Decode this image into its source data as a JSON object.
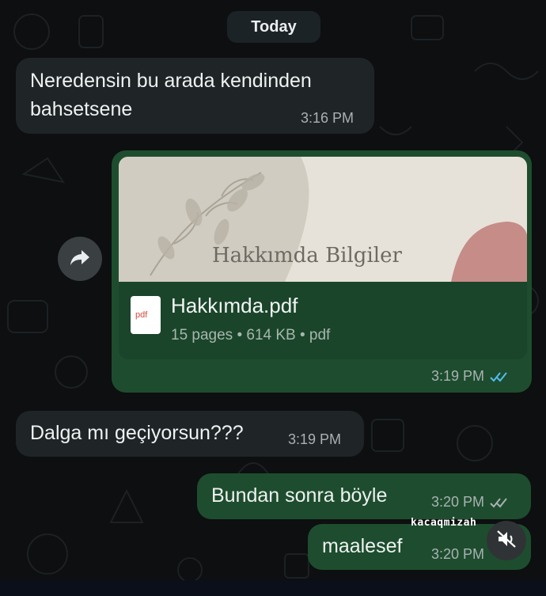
{
  "date_separator": "Today",
  "messages": [
    {
      "text_line1": "Neredensin bu arada kendinden",
      "text_line2": "bahsetsene",
      "time": "3:16 PM",
      "direction": "incoming"
    },
    {
      "direction": "outgoing",
      "document": {
        "preview_title": "Hakkımda Bilgiler",
        "file_name": "Hakkımda.pdf",
        "file_info": "15 pages • 614 KB • pdf",
        "icon_label": "pdf"
      },
      "time": "3:19 PM"
    },
    {
      "text": "Dalga mı geçiyorsun???",
      "time": "3:19 PM",
      "direction": "incoming"
    },
    {
      "text": "Bundan sonra böyle",
      "time": "3:20 PM",
      "direction": "outgoing"
    },
    {
      "text": "maalesef",
      "time": "3:20 PM",
      "direction": "outgoing"
    }
  ],
  "watermark": "kacaqmizah",
  "colors": {
    "background": "#0d0f10",
    "incoming_bubble": "#1f2427",
    "outgoing_bubble": "#1d4d2e",
    "read_ticks": "#53bdeb"
  },
  "icons": [
    "forward-icon",
    "pdf-icon",
    "read-receipt-icon",
    "mute-icon"
  ]
}
